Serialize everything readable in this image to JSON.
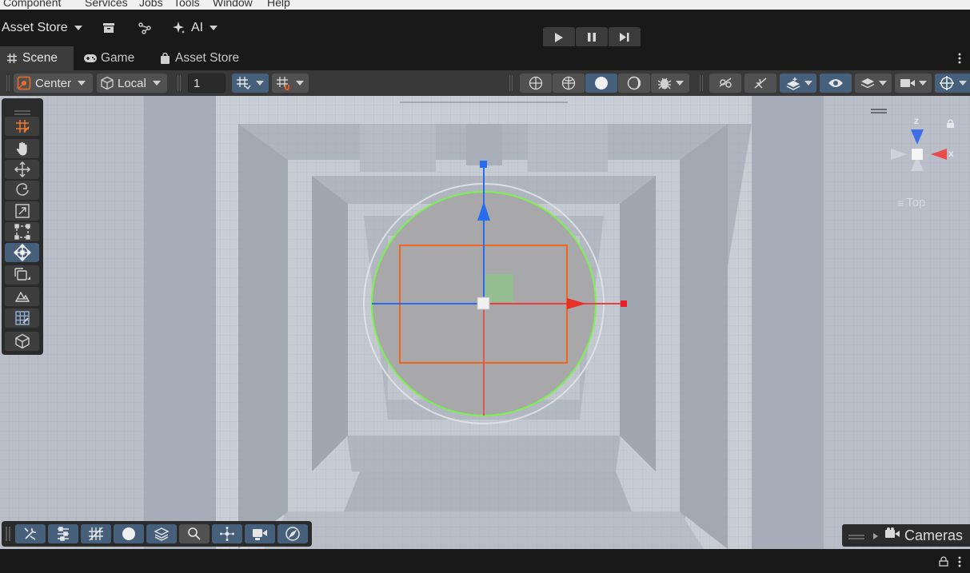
{
  "menubar": {
    "items": [
      "Component",
      "Services",
      "Jobs",
      "Tools",
      "Window",
      "Help"
    ]
  },
  "topbar": {
    "asset_store": "Asset Store",
    "ai": "AI"
  },
  "tabs": [
    {
      "label": "Scene",
      "active": true
    },
    {
      "label": "Game",
      "active": false
    },
    {
      "label": "Asset Store",
      "active": false
    }
  ],
  "scene_toolbar": {
    "pivot_mode": "Center",
    "pivot_rotation": "Local",
    "grid_size_value": "1"
  },
  "gizmo": {
    "z_label": "z",
    "x_label": "x",
    "view_label": "Top"
  },
  "overlays": {
    "cameras_label": "Cameras"
  },
  "colors": {
    "active_tool": "#46607c",
    "axis_x": "#e8403c",
    "axis_y": "#6fd43e",
    "axis_z": "#2a6cf0",
    "collider_green": "#7cf04c",
    "selection_orange": "#f0641e"
  }
}
